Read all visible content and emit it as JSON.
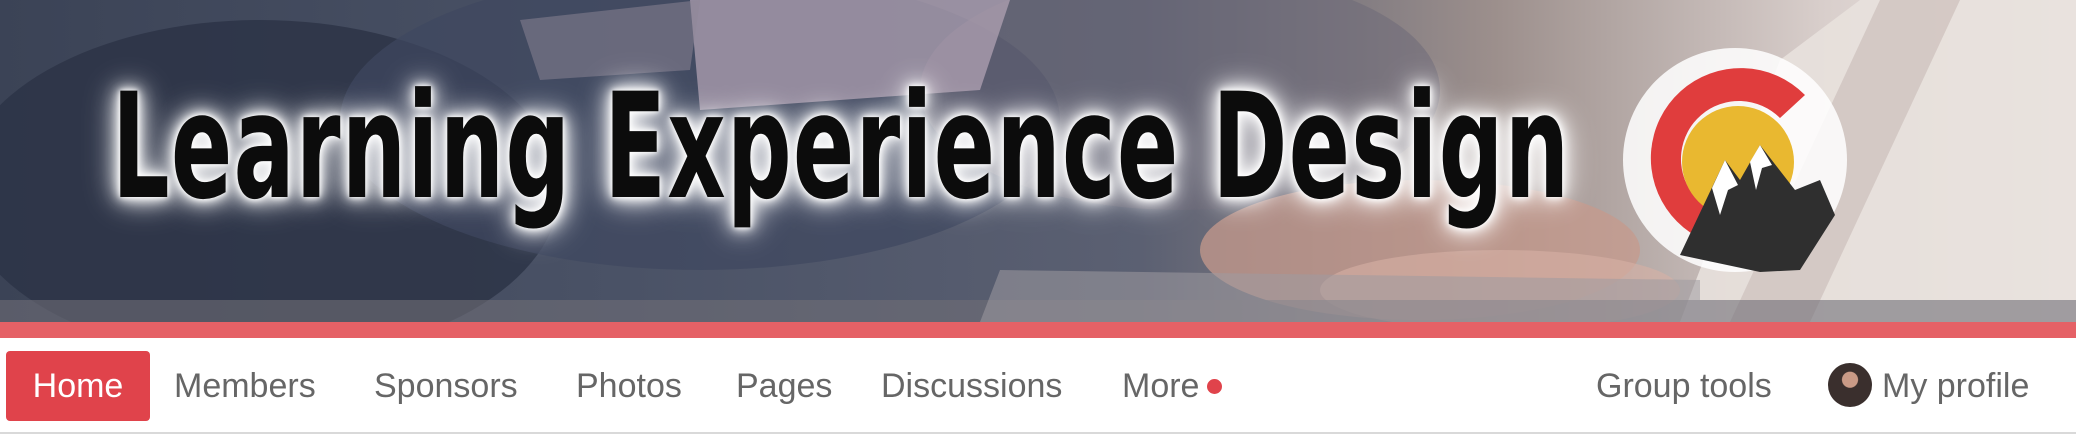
{
  "banner": {
    "title": "Learning Experience Design",
    "logo_icon": "colorado-mountain-logo-icon",
    "photo_icon": "laptop-typing-photo",
    "strip_color": "#e56166"
  },
  "nav": {
    "home_label": "Home",
    "members_label": "Members",
    "sponsors_label": "Sponsors",
    "photos_label": "Photos",
    "pages_label": "Pages",
    "discussions_label": "Discussions",
    "more_label": "More",
    "group_tools_label": "Group tools",
    "profile_label": "My profile",
    "active_color": "#e0434b",
    "text_color": "#666666"
  }
}
